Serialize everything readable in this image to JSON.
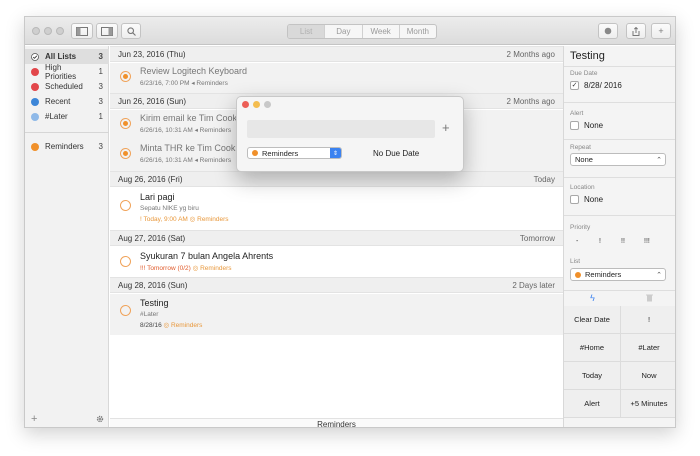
{
  "toolbar": {
    "view_tabs": [
      "List",
      "Day",
      "Week",
      "Month"
    ],
    "active_view": "List",
    "search_icon": "search-icon",
    "add_label": "+"
  },
  "sidebar": {
    "items": [
      {
        "label": "All Lists",
        "count": "3",
        "color": "#ffffff"
      },
      {
        "label": "High Priorities",
        "count": "1",
        "color": "#e2464a"
      },
      {
        "label": "Scheduled",
        "count": "3",
        "color": "#e2464a"
      },
      {
        "label": "Recent",
        "count": "3",
        "color": "#3d86d8"
      },
      {
        "label": "#Later",
        "count": "1",
        "color": "#8fb9e8"
      }
    ],
    "lists": [
      {
        "label": "Reminders",
        "count": "3",
        "color": "#f0902a"
      }
    ],
    "add_label": "+"
  },
  "main": {
    "groups": [
      {
        "date": "Jun 23, 2016 (Thu)",
        "ago": "2 Months ago"
      },
      {
        "date": "Jun 26, 2016 (Sun)",
        "ago": "2 Months ago"
      },
      {
        "date": "Aug 26, 2016 (Fri)",
        "ago": "Today"
      },
      {
        "date": "Aug 27, 2016 (Sat)",
        "ago": "Tomorrow"
      },
      {
        "date": "Aug 28, 2016 (Sun)",
        "ago": "2 Days later"
      }
    ],
    "tasks": [
      {
        "title": "Review Logitech Keyboard",
        "meta": "6/23/16, 7:00 PM",
        "list": "Reminders"
      },
      {
        "title": "Kirim email ke Tim Cook,",
        "meta": "6/26/16, 10:31 AM",
        "list": "Reminders"
      },
      {
        "title": "Minta THR ke Tim Cook",
        "meta": "6/26/16, 10:31 AM",
        "list": "Reminders"
      },
      {
        "title": "Lari pagi",
        "note": "Sepatu NIKE yg biru",
        "meta": "! Today, 9:00 AM",
        "list": "Reminders"
      },
      {
        "title": "Syukuran 7 bulan Angela Ahrents",
        "meta": "!!! Tomorrow (0/2)",
        "list": "Reminders"
      },
      {
        "title": "Testing",
        "note": "#Later",
        "meta": "8/28/16",
        "list": "Reminders"
      }
    ],
    "footer": "Reminders"
  },
  "detail": {
    "title": "Testing",
    "due_date_label": "Due Date",
    "due_date_value": "8/28/ 2016",
    "alert_label": "Alert",
    "alert_value": "None",
    "repeat_label": "Repeat",
    "repeat_value": "None",
    "location_label": "Location",
    "location_value": "None",
    "priority_label": "Priority",
    "priority_options": [
      "-",
      "!",
      "!!",
      "!!!"
    ],
    "list_label": "List",
    "list_value": "Reminders",
    "quick_buttons": [
      "Clear Date",
      "!",
      "#Home",
      "#Later",
      "Today",
      "Now",
      "Alert",
      "+5 Minutes"
    ]
  },
  "popup": {
    "list_value": "Reminders",
    "due_text": "No Due Date",
    "add_label": "+"
  }
}
